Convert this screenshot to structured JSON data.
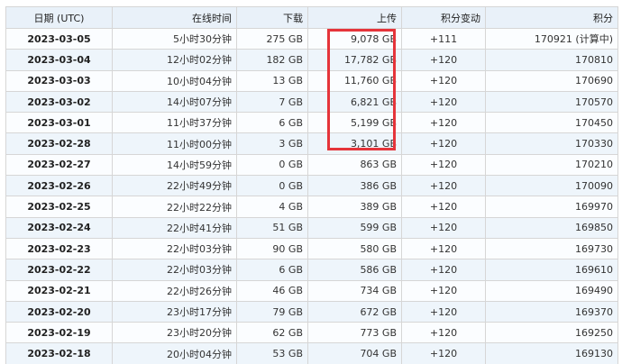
{
  "headers": {
    "date": "日期 (UTC)",
    "online": "在线时间",
    "download": "下载",
    "upload": "上传",
    "points_change": "积分变动",
    "points": "积分"
  },
  "rows": [
    {
      "date": "2023-03-05",
      "online": "5小时30分钟",
      "download": "275 GB",
      "upload": "9,078 GB",
      "change": "+111",
      "points": "170921 (计算中)"
    },
    {
      "date": "2023-03-04",
      "online": "12小时02分钟",
      "download": "182 GB",
      "upload": "17,782 GB",
      "change": "+120",
      "points": "170810"
    },
    {
      "date": "2023-03-03",
      "online": "10小时04分钟",
      "download": "13 GB",
      "upload": "11,760 GB",
      "change": "+120",
      "points": "170690"
    },
    {
      "date": "2023-03-02",
      "online": "14小时07分钟",
      "download": "7 GB",
      "upload": "6,821 GB",
      "change": "+120",
      "points": "170570"
    },
    {
      "date": "2023-03-01",
      "online": "11小时37分钟",
      "download": "6 GB",
      "upload": "5,199 GB",
      "change": "+120",
      "points": "170450"
    },
    {
      "date": "2023-02-28",
      "online": "11小时00分钟",
      "download": "3 GB",
      "upload": "3,101 GB",
      "change": "+120",
      "points": "170330"
    },
    {
      "date": "2023-02-27",
      "online": "14小时59分钟",
      "download": "0 GB",
      "upload": "863 GB",
      "change": "+120",
      "points": "170210"
    },
    {
      "date": "2023-02-26",
      "online": "22小时49分钟",
      "download": "0 GB",
      "upload": "386 GB",
      "change": "+120",
      "points": "170090"
    },
    {
      "date": "2023-02-25",
      "online": "22小时22分钟",
      "download": "4 GB",
      "upload": "389 GB",
      "change": "+120",
      "points": "169970"
    },
    {
      "date": "2023-02-24",
      "online": "22小时41分钟",
      "download": "51 GB",
      "upload": "599 GB",
      "change": "+120",
      "points": "169850"
    },
    {
      "date": "2023-02-23",
      "online": "22小时03分钟",
      "download": "90 GB",
      "upload": "580 GB",
      "change": "+120",
      "points": "169730"
    },
    {
      "date": "2023-02-22",
      "online": "22小时03分钟",
      "download": "6 GB",
      "upload": "586 GB",
      "change": "+120",
      "points": "169610"
    },
    {
      "date": "2023-02-21",
      "online": "22小时26分钟",
      "download": "46 GB",
      "upload": "734 GB",
      "change": "+120",
      "points": "169490"
    },
    {
      "date": "2023-02-20",
      "online": "23小时17分钟",
      "download": "79 GB",
      "upload": "672 GB",
      "change": "+120",
      "points": "169370"
    },
    {
      "date": "2023-02-19",
      "online": "23小时20分钟",
      "download": "62 GB",
      "upload": "773 GB",
      "change": "+120",
      "points": "169250"
    },
    {
      "date": "2023-02-18",
      "online": "20小时04分钟",
      "download": "53 GB",
      "upload": "704 GB",
      "change": "+120",
      "points": "169130"
    }
  ],
  "highlight_color": "#e5343a",
  "header_bg": "#e9f1f9",
  "row_alt_bg": "#eef5fb"
}
